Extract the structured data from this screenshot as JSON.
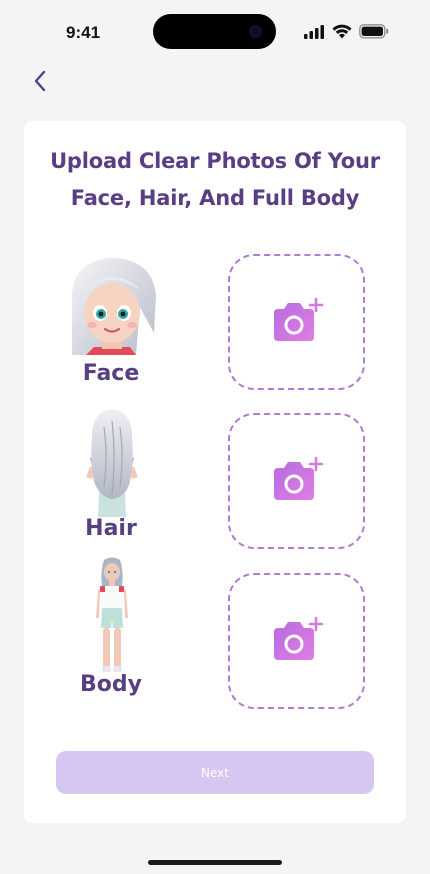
{
  "status_bar": {
    "time": "9:41"
  },
  "title": "Upload Clear Photos Of Your Face, Hair, And Full Body",
  "uploads": [
    {
      "label": "Face",
      "icon": "camera-add-icon"
    },
    {
      "label": "Hair",
      "icon": "camera-add-icon"
    },
    {
      "label": "Body",
      "icon": "camera-add-icon"
    }
  ],
  "next_label": "Next",
  "colors": {
    "accent": "#5a3e84",
    "button_disabled": "#d5c6f2",
    "dashed_border": "#b37ad4",
    "camera_gradient_start": "#b66ce0",
    "camera_gradient_end": "#e27de4"
  }
}
